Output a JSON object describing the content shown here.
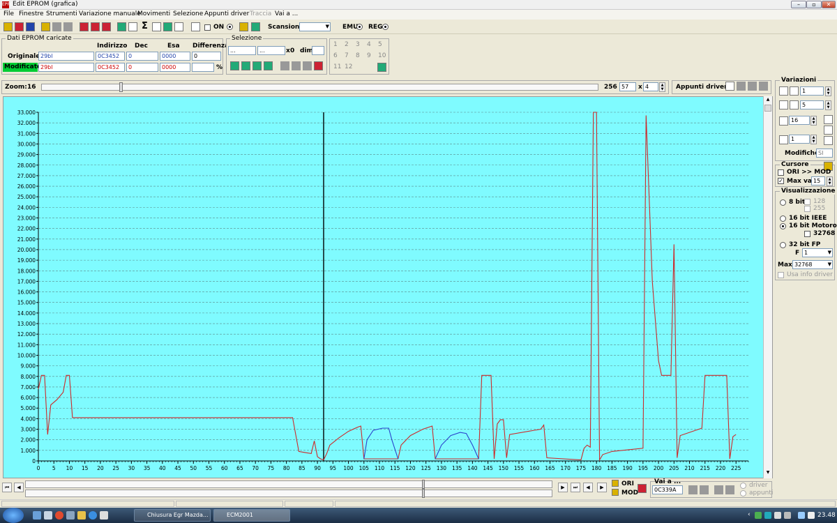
{
  "window": {
    "title": "Edit EPROM (grafica)",
    "icon_text": "EPROM"
  },
  "menu": [
    "File",
    "Finestre",
    "Strumenti",
    "Variazione manuale",
    "Movimenti",
    "Selezione",
    "Appunti driver",
    "Traccia",
    "Vai a ..."
  ],
  "menu_disabled_index": 7,
  "toolbar": {
    "on_label": "ON",
    "scansione_label": "Scansione",
    "emu_label": "EMU",
    "reg_label": "REG"
  },
  "eprom": {
    "group_title": "Dati EPROM caricate",
    "col_headers": [
      "Indirizzo",
      "Dec",
      "Esa",
      "Differenza"
    ],
    "originale": {
      "label": "Originale",
      "name": "29bl",
      "address": "0C3452",
      "dec": "0",
      "hex": "0000",
      "diff": "0"
    },
    "modificato": {
      "label": "Modificato",
      "name": "29bl",
      "address": "0C3452",
      "dec": "0",
      "hex": "0000",
      "diff": "",
      "percent": "%"
    }
  },
  "selezione": {
    "title": "Selezione",
    "from": "...",
    "to": "...",
    "x_label": "x",
    "x_value": "0",
    "dim_label": "dim."
  },
  "number_grid": [
    "1",
    "2",
    "3",
    "4",
    "5",
    "6",
    "7",
    "8",
    "9",
    "10",
    "11",
    "12"
  ],
  "zoom": {
    "label": "Zoom:",
    "value": "16",
    "max": "256",
    "field1": "57",
    "x_label": "x",
    "field2": "4",
    "slider_fraction": 0.14
  },
  "appunti_driver_label": "Appunti driver:",
  "variazioni": {
    "title": "Variazioni",
    "value1": "1",
    "value2": "5",
    "value3": "16",
    "value4": "1",
    "modifiche_label": "Modifiche:",
    "modifiche_value": "SI"
  },
  "cursore": {
    "title": "Cursore",
    "ori_mod_label": "ORI >> MOD",
    "max_var_label": "Max var",
    "max_var_value": "15"
  },
  "visualizzazione": {
    "title": "Visualizzazione",
    "bit8_label": "8 bit",
    "opt128": "128",
    "opt255": "255",
    "ieee_label": "16 bit IEEE",
    "motorola_label": "16 bit Motorola",
    "opt32768": "32768",
    "fp_label": "32 bit FP",
    "f_label": "F",
    "f_value": "1",
    "max_label": "Max",
    "max_value": "32768",
    "usa_info_label": "Usa info driver"
  },
  "nav": {
    "ori_label": "ORI",
    "mod_label": "MOD",
    "vai_a_label": "Vai a ...",
    "vai_a_value": "0C339A",
    "driver_label": "driver",
    "appunti_label": "appunti"
  },
  "taskbar": {
    "items": [
      "Chiusura Egr Mazda...",
      "ECM2001"
    ],
    "clock": "23.48"
  },
  "colors": {
    "chart_bg": "#7ffbff",
    "series_red": "#cc2a2a",
    "series_blue": "#2a44cc",
    "grid": "#5a8a8a",
    "modificato_bg": "#00cc33"
  },
  "chart_data": {
    "type": "line",
    "x_ticks": [
      0,
      5,
      10,
      15,
      20,
      25,
      30,
      35,
      40,
      45,
      50,
      55,
      60,
      65,
      70,
      75,
      80,
      85,
      90,
      95,
      100,
      105,
      110,
      115,
      120,
      125,
      130,
      135,
      140,
      145,
      150,
      155,
      160,
      165,
      170,
      175,
      180,
      185,
      190,
      195,
      200,
      205,
      210,
      215,
      220,
      225
    ],
    "y_ticks": [
      "0",
      "1.000",
      "2.000",
      "3.000",
      "4.000",
      "5.000",
      "6.000",
      "7.000",
      "8.000",
      "9.000",
      "10.000",
      "11.000",
      "12.000",
      "13.000",
      "14.000",
      "15.000",
      "16.000",
      "17.000",
      "18.000",
      "19.000",
      "20.000",
      "21.000",
      "22.000",
      "23.000",
      "24.000",
      "25.000",
      "26.000",
      "27.000",
      "28.000",
      "29.000",
      "30.000",
      "31.000",
      "32.000",
      "33.000"
    ],
    "xlim": [
      0,
      229
    ],
    "ylim": [
      0,
      33000
    ],
    "grid": true,
    "cursor_x": 92,
    "series": [
      {
        "points": [
          [
            0,
            6800
          ],
          [
            1,
            8100
          ],
          [
            2,
            8100
          ],
          [
            3,
            2500
          ],
          [
            4,
            5300
          ],
          [
            6,
            5800
          ],
          [
            8,
            6500
          ],
          [
            9,
            8100
          ],
          [
            10,
            8100
          ],
          [
            11,
            4100
          ],
          [
            82,
            4100
          ],
          [
            84,
            900
          ],
          [
            86,
            800
          ],
          [
            88,
            700
          ],
          [
            89,
            1900
          ],
          [
            90,
            400
          ],
          [
            91,
            200
          ],
          [
            92,
            100
          ],
          [
            93,
            700
          ],
          [
            94,
            1500
          ],
          [
            97,
            2200
          ],
          [
            100,
            2800
          ],
          [
            103,
            3200
          ],
          [
            104,
            3300
          ],
          [
            105,
            200
          ],
          [
            116,
            200
          ],
          [
            117,
            1500
          ],
          [
            120,
            2400
          ],
          [
            124,
            3000
          ],
          [
            127,
            3300
          ],
          [
            128,
            200
          ],
          [
            142,
            200
          ],
          [
            143,
            8100
          ],
          [
            146,
            8100
          ],
          [
            147,
            200
          ],
          [
            148,
            3500
          ],
          [
            149,
            3900
          ],
          [
            150,
            3900
          ],
          [
            151,
            300
          ],
          [
            152,
            2500
          ],
          [
            162,
            3000
          ],
          [
            163,
            3400
          ],
          [
            164,
            300
          ],
          [
            175,
            100
          ],
          [
            176,
            1200
          ],
          [
            177,
            1500
          ],
          [
            178,
            1300
          ],
          [
            179,
            33000
          ],
          [
            180,
            33000
          ],
          [
            181,
            100
          ],
          [
            182,
            600
          ],
          [
            185,
            900
          ],
          [
            195,
            1200
          ],
          [
            196,
            32700
          ],
          [
            198,
            17000
          ],
          [
            200,
            9500
          ],
          [
            201,
            8100
          ],
          [
            204,
            8100
          ],
          [
            205,
            20500
          ],
          [
            206,
            300
          ],
          [
            207,
            2400
          ],
          [
            214,
            3100
          ],
          [
            215,
            8100
          ],
          [
            222,
            8100
          ],
          [
            223,
            200
          ],
          [
            224,
            2300
          ],
          [
            225,
            2500
          ]
        ]
      },
      {
        "points": [
          [
            105,
            200
          ],
          [
            106,
            2000
          ],
          [
            108,
            2900
          ],
          [
            111,
            3100
          ],
          [
            113,
            3100
          ],
          [
            114,
            2000
          ],
          [
            116,
            200
          ]
        ]
      },
      {
        "points": [
          [
            128,
            200
          ],
          [
            130,
            1500
          ],
          [
            133,
            2400
          ],
          [
            136,
            2700
          ],
          [
            138,
            2600
          ],
          [
            140,
            1500
          ],
          [
            142,
            200
          ]
        ]
      }
    ]
  }
}
